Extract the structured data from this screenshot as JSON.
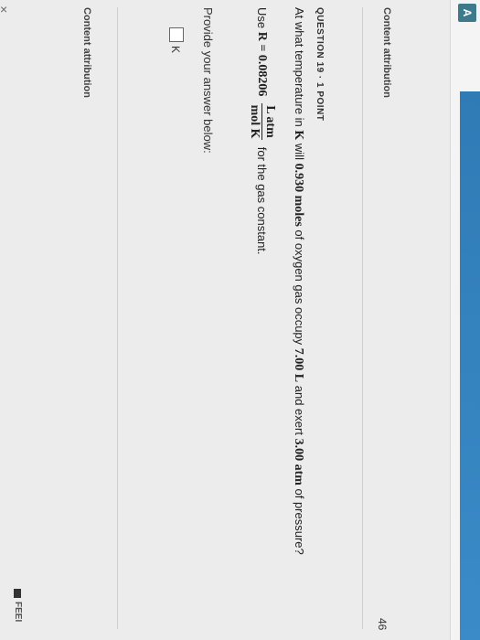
{
  "page": {
    "number": "46"
  },
  "top_attribution": "Content attribution",
  "question": {
    "header": "QUESTION 19 · 1 POINT",
    "line1_pre": "At what temperature in ",
    "line1_K": "K",
    "line1_mid1": " will ",
    "line1_moles": "0.930 moles",
    "line1_mid2": " of oxygen gas occupy ",
    "line1_vol": "7.00 L",
    "line1_mid3": " and exert ",
    "line1_pres": "3.00 atm",
    "line1_post": " of pressure?",
    "line2_pre": "Use ",
    "line2_R": "R = 0.08206",
    "frac_num": "L atm",
    "frac_den": "mol K",
    "line2_post": "for the gas constant."
  },
  "answer": {
    "prompt": "Provide your answer below:",
    "unit": "K"
  },
  "bottom_attribution": "Content attribution",
  "feedback_label": "FEEI"
}
